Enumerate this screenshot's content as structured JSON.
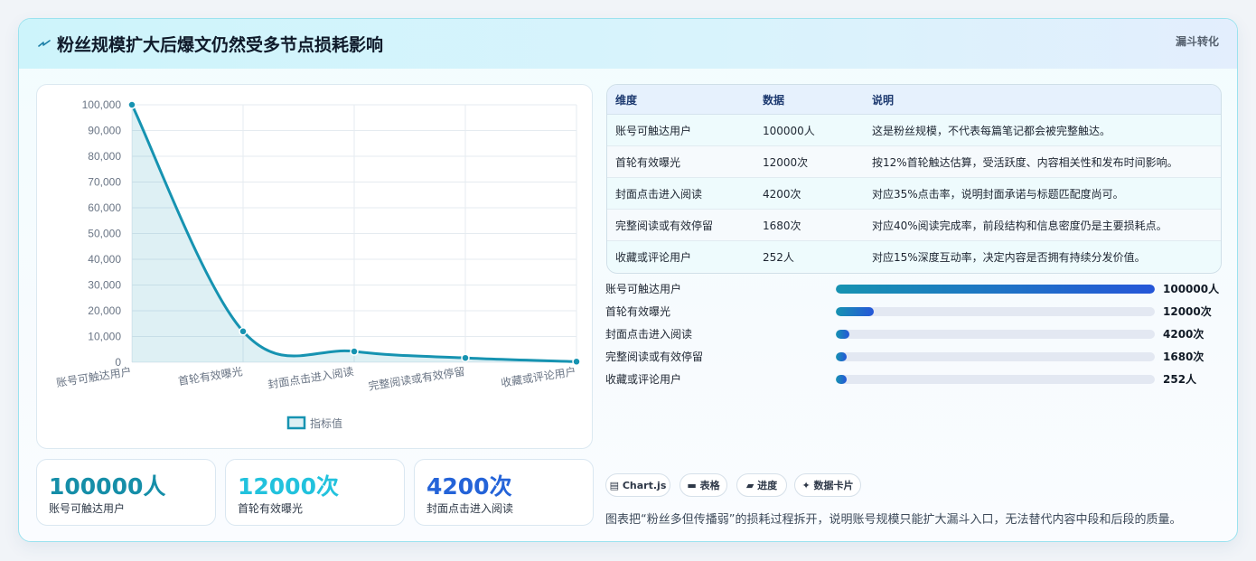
{
  "header": {
    "title": "粉丝规模扩大后爆文仍然受多节点损耗影响",
    "badge": "漏斗转化",
    "accent": "#1693b1"
  },
  "chart_data": {
    "type": "line",
    "categories": [
      "账号可触达用户",
      "首轮有效曝光",
      "封面点击进入阅读",
      "完整阅读或有效停留",
      "收藏或评论用户"
    ],
    "series": [
      {
        "name": "指标值",
        "values": [
          100000,
          12000,
          4200,
          1680,
          252
        ]
      }
    ],
    "yticks": [
      "100,000",
      "90,000",
      "80,000",
      "70,000",
      "60,000",
      "50,000",
      "40,000",
      "30,000",
      "20,000",
      "10,000",
      "0"
    ],
    "ylim": [
      0,
      100000
    ],
    "fill": true,
    "grid": true,
    "legend": "bottom",
    "color": "#1693b1"
  },
  "table": {
    "headers": [
      "维度",
      "数据",
      "说明"
    ],
    "rows": [
      [
        "账号可触达用户",
        "100000人",
        "这是粉丝规模，不代表每篇笔记都会被完整触达。"
      ],
      [
        "首轮有效曝光",
        "12000次",
        "按12%首轮触达估算，受活跃度、内容相关性和发布时间影响。"
      ],
      [
        "封面点击进入阅读",
        "4200次",
        "对应35%点击率，说明封面承诺与标题匹配度尚可。"
      ],
      [
        "完整阅读或有效停留",
        "1680次",
        "对应40%阅读完成率，前段结构和信息密度仍是主要损耗点。"
      ],
      [
        "收藏或评论用户",
        "252人",
        "对应15%深度互动率，决定内容是否拥有持续分发价值。"
      ]
    ]
  },
  "progress": [
    {
      "label": "账号可触达用户",
      "value": "100000人",
      "fraction": 1.0
    },
    {
      "label": "首轮有效曝光",
      "value": "12000次",
      "fraction": 0.12
    },
    {
      "label": "封面点击进入阅读",
      "value": "4200次",
      "fraction": 0.042
    },
    {
      "label": "完整阅读或有效停留",
      "value": "1680次",
      "fraction": 0.0168
    },
    {
      "label": "收藏或评论用户",
      "value": "252人",
      "fraction": 0.00252
    }
  ],
  "kpis": [
    {
      "value": "100000人",
      "label": "账号可触达用户",
      "color": "#158ea8"
    },
    {
      "value": "12000次",
      "label": "首轮有效曝光",
      "color": "#22c2dd"
    },
    {
      "value": "4200次",
      "label": "封面点击进入阅读",
      "color": "#2463d8"
    }
  ],
  "chips": [
    {
      "icon": "chart-icon",
      "label": "Chart.js"
    },
    {
      "icon": "table-icon",
      "label": "表格"
    },
    {
      "icon": "progress-icon",
      "label": "进度"
    },
    {
      "icon": "sparkle-icon",
      "label": "数据卡片"
    }
  ],
  "note": "图表把“粉丝多但传播弱”的损耗过程拆开，说明账号规模只能扩大漏斗入口，无法替代内容中段和后段的质量。"
}
